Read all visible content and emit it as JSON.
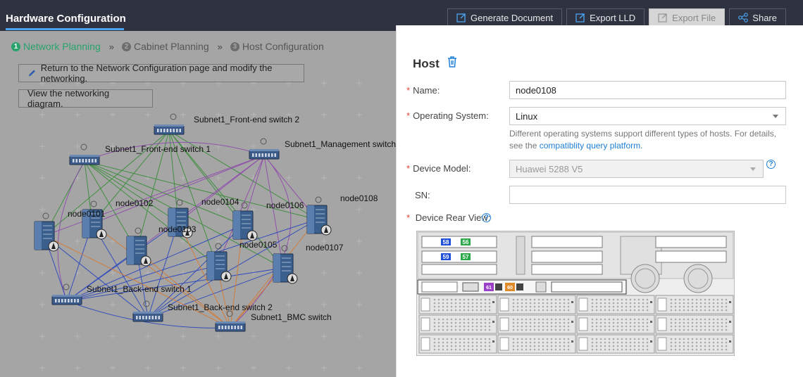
{
  "app": {
    "title": "Hardware Configuration"
  },
  "toolbar": {
    "generate_label": "Generate Document",
    "export_lld_label": "Export LLD",
    "export_file_label": "Export File",
    "share_label": "Share"
  },
  "steps": [
    {
      "num": "1",
      "label": "Network Planning"
    },
    {
      "num": "2",
      "label": "Cabinet Planning"
    },
    {
      "num": "3",
      "label": "Host Configuration"
    }
  ],
  "step_separator": "»",
  "workspace": {
    "return_label": "Return to the Network Configuration page and modify the networking.",
    "view_label": "View the networking diagram."
  },
  "diagram": {
    "switches": {
      "fe2": "Subnet1_Front-end switch 2",
      "fe1": "Subnet1_Front-end switch 1",
      "mgmt": "Subnet1_Management switch",
      "be1": "Subnet1_Back-end switch 1",
      "be2": "Subnet1_Back-end switch 2",
      "bmc": "Subnet1_BMC switch"
    },
    "nodes": {
      "n0101": "node0101",
      "n0102": "node0102",
      "n0103": "node0103",
      "n0104": "node0104",
      "n0105": "node0105",
      "n0106": "node0106",
      "n0107": "node0107",
      "n0108": "node0108"
    },
    "colors": {
      "frontend": "#2ca02c",
      "management": "#8e44ad",
      "backend": "#1f3fbf",
      "bmc": "#e67e22"
    }
  },
  "panel": {
    "title": "Host",
    "name_label": "Name:",
    "name_value": "node0108",
    "os_label": "Operating System:",
    "os_value": "Linux",
    "os_help": "Different operating systems support different types of hosts. For details, see the",
    "os_help_link": "compatiblity query platform.",
    "model_label": "Device Model:",
    "model_value": "Huawei 5288 V5",
    "sn_label": "SN:",
    "sn_value": "",
    "rear_label": "Device Rear View:",
    "rear_ports": {
      "p58": "58",
      "p56": "56",
      "p59": "59",
      "p57": "57",
      "p61": "61",
      "p60": "60"
    }
  }
}
